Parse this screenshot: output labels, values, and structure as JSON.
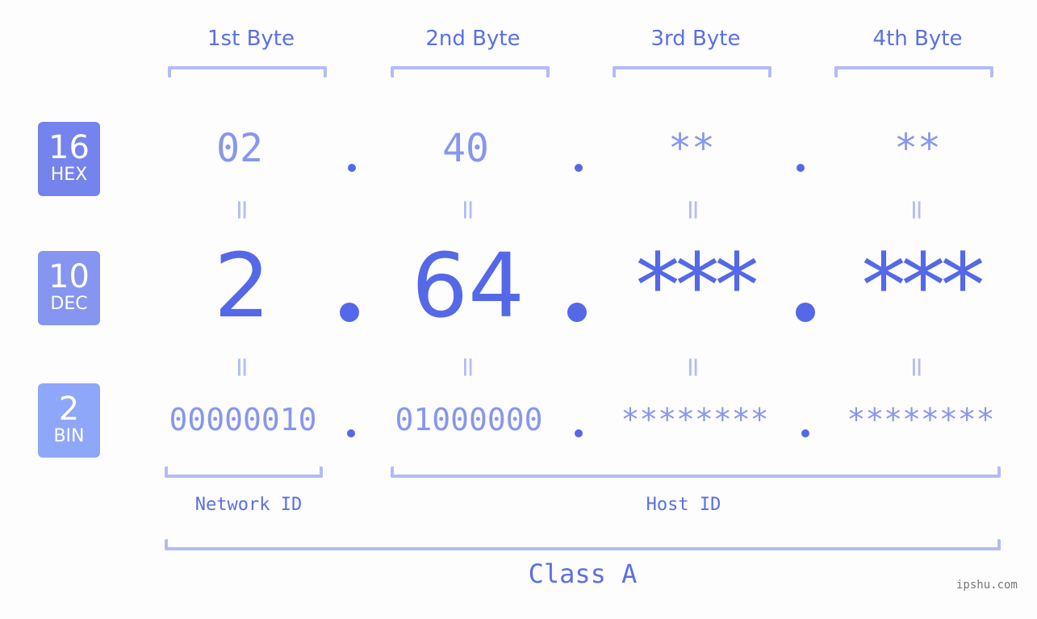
{
  "headers": [
    "1st Byte",
    "2nd Byte",
    "3rd Byte",
    "4th Byte"
  ],
  "badges": [
    {
      "num": "16",
      "label": "HEX",
      "color": "#7583ec"
    },
    {
      "num": "10",
      "label": "DEC",
      "color": "#8595f0"
    },
    {
      "num": "2",
      "label": "BIN",
      "color": "#8fa7f8"
    }
  ],
  "hex": [
    "02",
    "40",
    "**",
    "**"
  ],
  "dec": [
    "2",
    "64",
    "***",
    "***"
  ],
  "bin": [
    "00000010",
    "01000000",
    "********",
    "********"
  ],
  "equals": "=",
  "labels": {
    "network_id": "Network ID",
    "host_id": "Host ID",
    "class": "Class A"
  },
  "watermark": "ipshu.com",
  "colors": {
    "accent": "#5468e8",
    "light": "#8796ef",
    "bracket": "#b3bcf7"
  }
}
